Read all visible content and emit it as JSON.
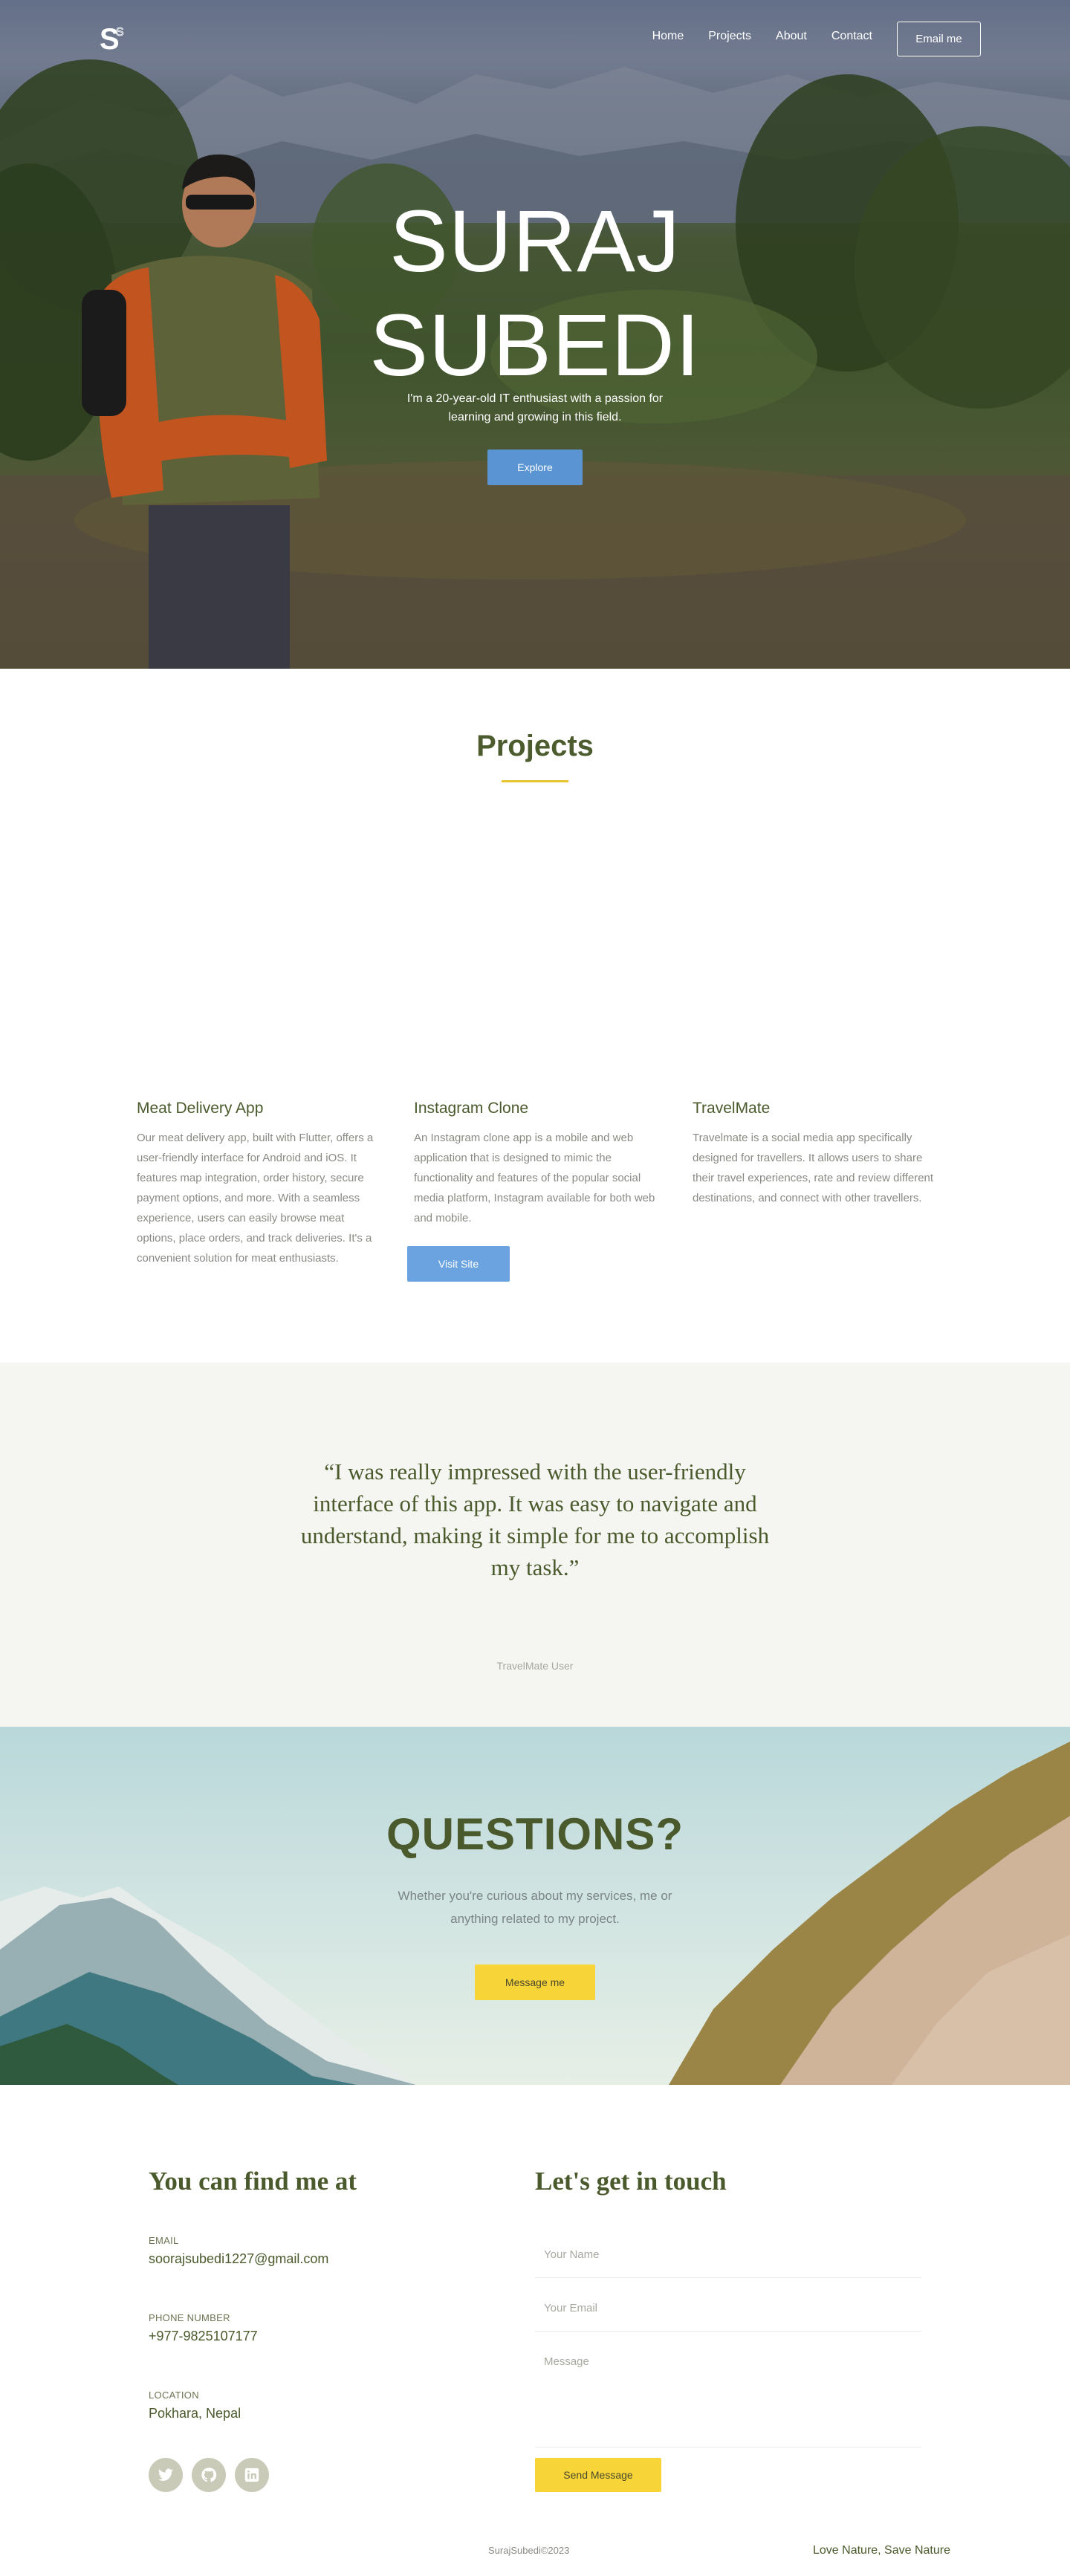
{
  "nav": {
    "logo": "S",
    "links": [
      "Home",
      "Projects",
      "About",
      "Contact"
    ],
    "cta": "Email me"
  },
  "hero": {
    "title_line1": "SURAJ",
    "title_line2": "SUBEDI",
    "subtitle": "I'm a 20-year-old IT enthusiast with a passion for learning and growing in this field.",
    "button": "Explore"
  },
  "projects": {
    "title": "Projects",
    "items": [
      {
        "title": "Meat Delivery App",
        "description": "Our meat delivery app, built with Flutter, offers a user-friendly interface for Android and iOS. It features map integration, order history, secure payment options, and more. With a seamless experience, users can easily browse meat options, place orders, and track deliveries. It's a convenient solution for meat enthusiasts."
      },
      {
        "title": "Instagram Clone",
        "description": "An Instagram clone app is a mobile and web application that is designed to mimic the functionality and features of the popular social media platform, Instagram available for both web and mobile.",
        "button": "Visit Site"
      },
      {
        "title": "TravelMate",
        "description": "Travelmate is a social media app specifically designed for travellers. It allows users to share their travel experiences, rate and review different destinations, and connect with other travellers."
      }
    ]
  },
  "testimonial": {
    "quote": "“I was really impressed with the user-friendly interface of this app. It was easy to navigate and understand, making it simple for me to accomplish my task.”",
    "author": "TravelMate User"
  },
  "questions": {
    "title": "QUESTIONS?",
    "subtitle": "Whether you're curious about my services, me or anything related to my project.",
    "button": "Message me"
  },
  "contact": {
    "left_title": "You can find me at",
    "email_label": "EMAIL",
    "email": "soorajsubedi1227@gmail.com",
    "phone_label": "PHONE NUMBER",
    "phone": "+977-9825107177",
    "location_label": "LOCATION",
    "location": "Pokhara, Nepal",
    "socials": [
      "twitter-icon",
      "github-icon",
      "linkedin-icon"
    ],
    "right_title": "Let's get in touch",
    "name_placeholder": "Your Name",
    "email_placeholder": "Your Email",
    "message_placeholder": "Message",
    "send_button": "Send Message"
  },
  "footer": {
    "copyright": "SurajSubedi©2023",
    "motto": "Love Nature, Save Nature"
  },
  "colors": {
    "accent_green": "#4a5a2c",
    "accent_yellow": "#f7d438",
    "button_blue": "#5a94d2"
  }
}
